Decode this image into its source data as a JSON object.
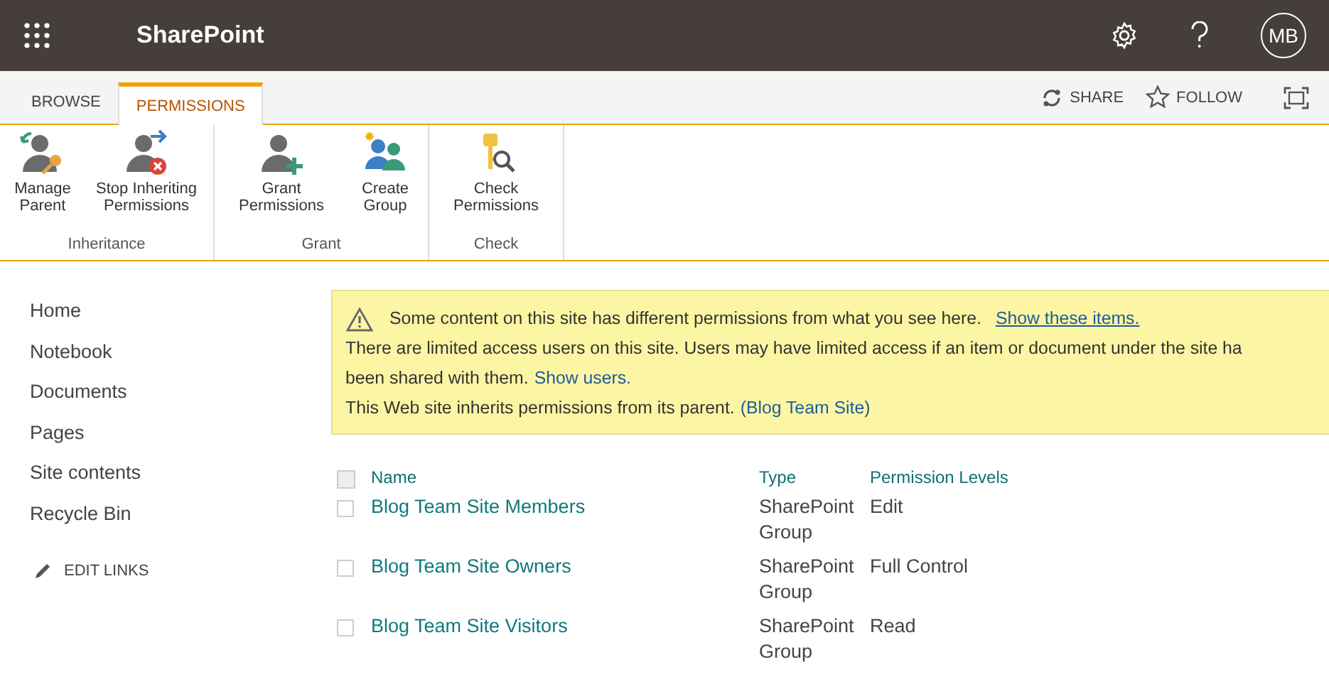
{
  "app_bar": {
    "title": "SharePoint",
    "avatar": "MB"
  },
  "ribbon": {
    "tabs": [
      {
        "label": "BROWSE",
        "selected": false
      },
      {
        "label": "PERMISSIONS",
        "selected": true
      }
    ],
    "actions": [
      {
        "label": "SHARE",
        "kind": "share"
      },
      {
        "label": "FOLLOW",
        "kind": "follow"
      }
    ],
    "groups": [
      {
        "label": "Inheritance",
        "buttons": [
          {
            "label": "Manage Parent",
            "kind": "manage"
          },
          {
            "label": "Stop Inheriting Permissions",
            "kind": "stop"
          }
        ]
      },
      {
        "label": "Grant",
        "buttons": [
          {
            "label": "Grant Permissions",
            "kind": "grant"
          },
          {
            "label": "Create Group",
            "kind": "create"
          }
        ]
      },
      {
        "label": "Check",
        "buttons": [
          {
            "label": "Check Permissions",
            "kind": "check"
          }
        ]
      }
    ]
  },
  "sidebar": {
    "items": [
      "Home",
      "Notebook",
      "Documents",
      "Pages",
      "Site contents",
      "Recycle Bin"
    ],
    "edit_links": "EDIT LINKS"
  },
  "notice": {
    "warning": "Some content on this site has different permissions from what you see here.",
    "warning_link": "Show these items.",
    "limited": "There are limited access users on this site. Users may have limited access if an item or document under the site ha",
    "limited_cont": "been shared with them.",
    "limited_link": "Show users.",
    "inherits": "This Web site inherits permissions from its parent.",
    "inherits_link": "(Blog Team Site)"
  },
  "table": {
    "select_all_checked": false,
    "columns": [
      "Name",
      "Type",
      "Permission Levels"
    ],
    "rows": [
      {
        "name": "Blog Team Site Members",
        "type": "SharePoint Group",
        "level": "Edit",
        "checked": false
      },
      {
        "name": "Blog Team Site Owners",
        "type": "SharePoint Group",
        "level": "Full Control",
        "checked": false
      },
      {
        "name": "Blog Team Site Visitors",
        "type": "SharePoint Group",
        "level": "Read",
        "checked": false
      }
    ]
  }
}
